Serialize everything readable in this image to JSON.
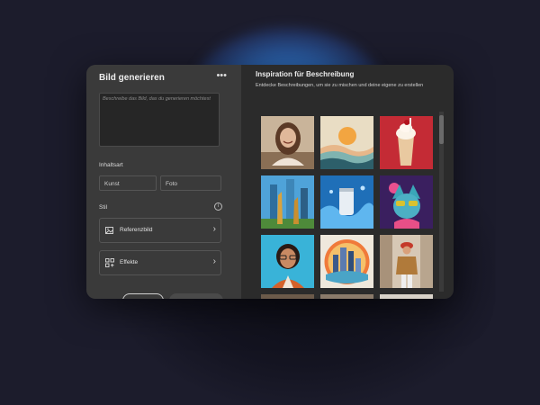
{
  "dialog": {
    "title": "Bild generieren",
    "more_icon": "more-horizontal-icon",
    "prompt_placeholder": "Beschreibe das Bild, das du generieren möchtest"
  },
  "content_type": {
    "label": "Inhaltsart",
    "options": [
      "Kunst",
      "Foto"
    ]
  },
  "style": {
    "label": "Stil",
    "info_icon": "info-icon",
    "items": [
      {
        "label": "Referenzbild",
        "icon": "reference-image-icon"
      },
      {
        "label": "Effekte",
        "icon": "effects-icon"
      }
    ]
  },
  "inspiration": {
    "title": "Inspiration für Beschreibung",
    "subtitle": "Entdecke Beschreibungen, um sie zu mischen und deine eigene zu erstellen"
  },
  "colors": {
    "left_panel": "#3a3a3a",
    "right_panel": "#2b2b2b",
    "background": "#1c1c2c"
  }
}
